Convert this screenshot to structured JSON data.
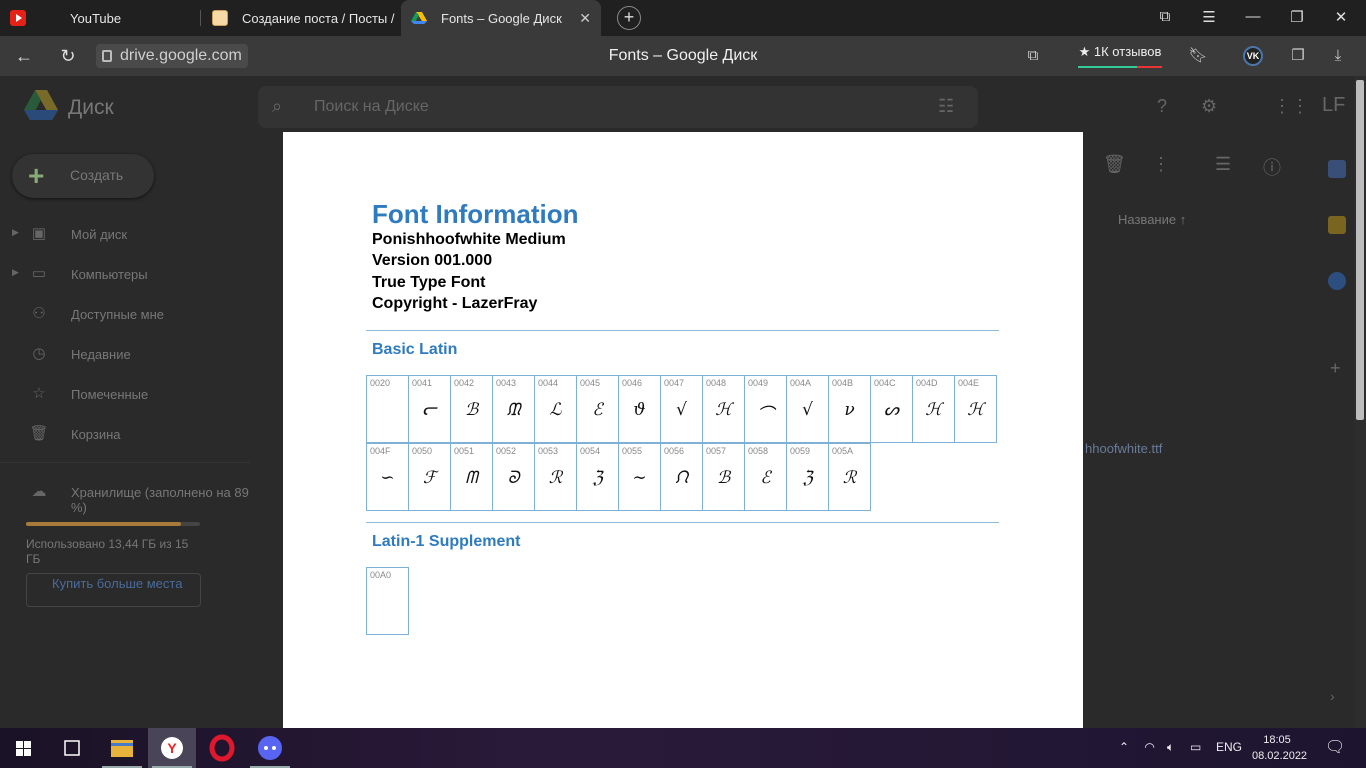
{
  "browser": {
    "tabs": [
      {
        "title": "YouTube",
        "favicon": "youtube-icon"
      },
      {
        "title": "Создание поста / Посты /",
        "favicon": "post-icon"
      },
      {
        "title": "Fonts – Google Диск",
        "favicon": "google-drive-icon",
        "active": true
      }
    ],
    "url": "drive.google.com",
    "page_title": "Fonts – Google Диск",
    "reviews_label": "★ 1К отзывов",
    "vk_label": "VK"
  },
  "drive": {
    "app_name": "Диск",
    "search_placeholder": "Поиск на Диске",
    "create_label": "Создать",
    "sidebar": [
      {
        "label": "Мой диск",
        "icon": "my-drive-icon"
      },
      {
        "label": "Компьютеры",
        "icon": "computers-icon"
      },
      {
        "label": "Доступные мне",
        "icon": "shared-icon"
      },
      {
        "label": "Недавние",
        "icon": "clock-icon"
      },
      {
        "label": "Помеченные",
        "icon": "star-icon"
      },
      {
        "label": "Корзина",
        "icon": "trash-icon"
      }
    ],
    "storage": {
      "label": "Хранилище (заполнено на 89 %)",
      "used_fraction": 0.89,
      "usage_text": "Использовано 13,44 ГБ из 15 ГБ",
      "buy_label": "Купить больше места"
    },
    "sort_label": "Название",
    "file_name": "hhoofwhite.ttf"
  },
  "preview": {
    "title": "Font Information",
    "font_name": "Ponishhoofwhite Medium",
    "version": "Version 001.000",
    "type": "True Type Font",
    "copyright": "Copyright - LazerFray",
    "sections": [
      {
        "name": "Basic Latin",
        "cells": [
          {
            "code": "0020",
            "glyph": ""
          },
          {
            "code": "0041",
            "glyph": "ᓕ"
          },
          {
            "code": "0042",
            "glyph": "ℬ"
          },
          {
            "code": "0043",
            "glyph": "ᙢ"
          },
          {
            "code": "0044",
            "glyph": "ℒ"
          },
          {
            "code": "0045",
            "glyph": "ℰ"
          },
          {
            "code": "0046",
            "glyph": "ϑ"
          },
          {
            "code": "0047",
            "glyph": "√"
          },
          {
            "code": "0048",
            "glyph": "ℋ"
          },
          {
            "code": "0049",
            "glyph": "⌒"
          },
          {
            "code": "004A",
            "glyph": "√"
          },
          {
            "code": "004B",
            "glyph": "ν"
          },
          {
            "code": "004C",
            "glyph": "ᔕ"
          },
          {
            "code": "004D",
            "glyph": "ℋ"
          },
          {
            "code": "004E",
            "glyph": "ℋ"
          },
          {
            "code": "004F",
            "glyph": "∽"
          },
          {
            "code": "0050",
            "glyph": "ℱ"
          },
          {
            "code": "0051",
            "glyph": "ᗰ"
          },
          {
            "code": "0052",
            "glyph": "ᘐ"
          },
          {
            "code": "0053",
            "glyph": "ℛ"
          },
          {
            "code": "0054",
            "glyph": "ℨ"
          },
          {
            "code": "0055",
            "glyph": "∼"
          },
          {
            "code": "0056",
            "glyph": "ᙁ"
          },
          {
            "code": "0057",
            "glyph": "ℬ"
          },
          {
            "code": "0058",
            "glyph": "ℰ"
          },
          {
            "code": "0059",
            "glyph": "ℨ"
          },
          {
            "code": "005A",
            "glyph": "ℛ"
          }
        ]
      },
      {
        "name": "Latin-1 Supplement",
        "cells": [
          {
            "code": "00A0",
            "glyph": ""
          }
        ]
      }
    ]
  },
  "taskbar": {
    "language": "ENG",
    "time": "18:05",
    "date": "08.02.2022"
  }
}
